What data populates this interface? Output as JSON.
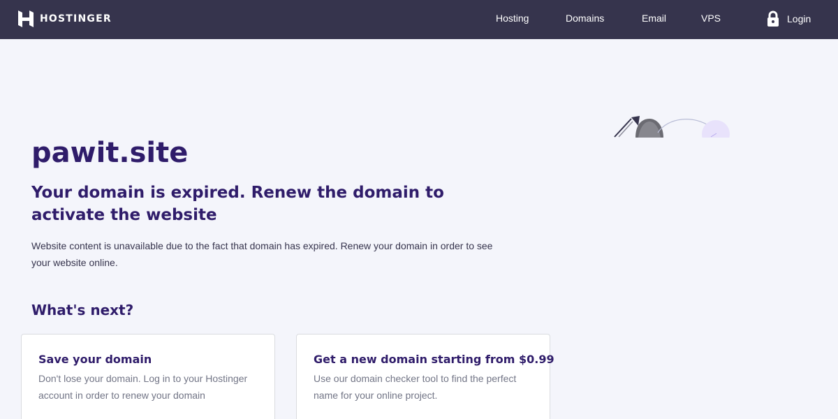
{
  "brand": {
    "name": "HOSTINGER",
    "logo_icon": "hostinger-logo-icon",
    "topbar_color": "#36344d",
    "text_color": "#2f1c6a"
  },
  "nav": {
    "items": [
      {
        "label": "Hosting"
      },
      {
        "label": "Domains"
      },
      {
        "label": "Email"
      },
      {
        "label": "VPS"
      }
    ],
    "login_label": "Login",
    "login_icon": "lock-icon"
  },
  "main": {
    "domain": "pawit.site",
    "headline": "Your domain is expired. Renew the domain to activate the website",
    "description": "Website content is unavailable due to the fact that domain has expired. Renew your domain in order to see your website online.",
    "next_title": "What's next?"
  },
  "cards": [
    {
      "title": "Save your domain",
      "text": "Don't lose your domain. Log in to your Hostinger account in order to renew your domain"
    },
    {
      "title": "Get a new domain starting from $0.99",
      "text": "Use our domain checker tool to find the perfect name for your online project."
    }
  ]
}
